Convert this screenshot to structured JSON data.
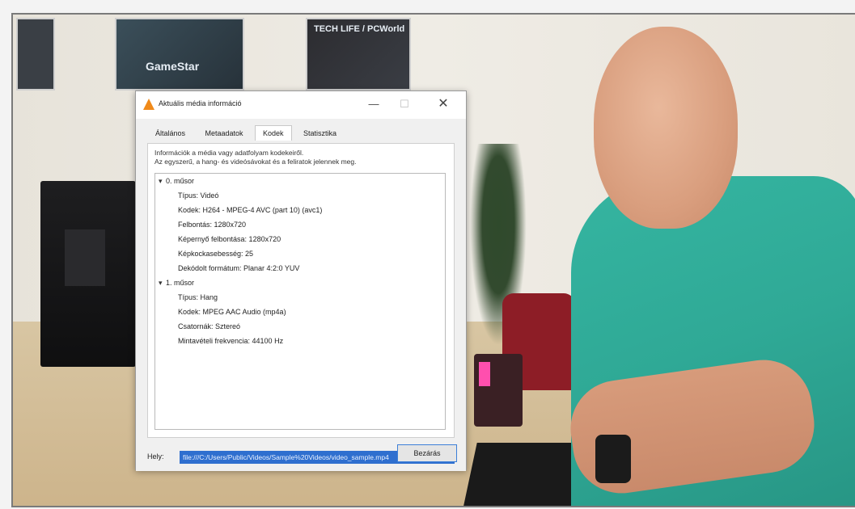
{
  "background": {
    "posters": [
      {
        "text": ""
      },
      {
        "text": "GameStar"
      },
      {
        "text": "TECH LIFE / PCWorld"
      }
    ]
  },
  "dialog": {
    "title": "Aktuális média információ",
    "window_controls": {
      "minimize": "—",
      "maximize": "☐",
      "close": "✕"
    },
    "tabs": [
      {
        "label": "Általános"
      },
      {
        "label": "Metaadatok"
      },
      {
        "label": "Kodek"
      },
      {
        "label": "Statisztika"
      }
    ],
    "active_tab": "Kodek",
    "info_line1": "Információk a média vagy adatfolyam kodekeiről.",
    "info_line2": "Az egyszerű, a hang- és videósávokat és a feliratok jelennek meg.",
    "streams": [
      {
        "label": "0. műsor",
        "fields": [
          "Típus: Videó",
          "Kodek: H264 - MPEG-4 AVC (part 10) (avc1)",
          "Felbontás: 1280x720",
          "Képernyő felbontása: 1280x720",
          "Képkockasebesség: 25",
          "Dekódolt formátum: Planar 4:2:0 YUV"
        ]
      },
      {
        "label": "1. műsor",
        "fields": [
          "Típus: Hang",
          "Kodek: MPEG AAC Audio (mp4a)",
          "Csatornák: Sztereó",
          "Mintavételi frekvencia: 44100 Hz"
        ]
      }
    ],
    "location_label": "Hely:",
    "location_value": "file:///C:/Users/Public/Videos/Sample%20Videos/video_sample.mp4",
    "close_button": "Bezárás"
  }
}
